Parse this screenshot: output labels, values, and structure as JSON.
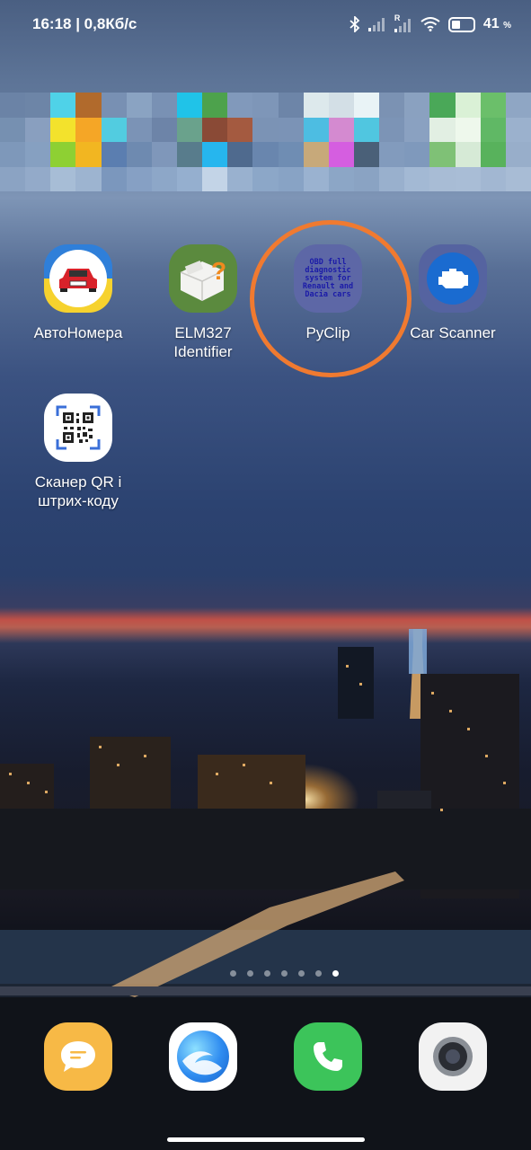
{
  "status_bar": {
    "time_speed": "16:18 | 0,8Кб/с",
    "network_r": "R",
    "battery_percent": "41",
    "battery_unit": "%",
    "battery_level": 0.41
  },
  "apps": [
    {
      "label": "АвтоНомера",
      "icon": "car-plate-icon"
    },
    {
      "label": "ELM327 Identifier",
      "icon": "obd-adapter-icon"
    },
    {
      "label": "PyClip",
      "icon_text": "OBD full diagnostic system for Renault and Dacia cars",
      "icon": "pyclip-icon"
    },
    {
      "label": "Car Scanner",
      "icon": "engine-check-icon"
    },
    {
      "label": "Сканер QR і штрих-коду",
      "icon": "qr-scanner-icon"
    }
  ],
  "page_indicator": {
    "count": 7,
    "active_index": 6
  },
  "dock": [
    {
      "icon": "messages-icon",
      "color": "#f7b946"
    },
    {
      "icon": "browser-icon",
      "color": "#2f8cf0"
    },
    {
      "icon": "phone-icon",
      "color": "#3cc45a"
    },
    {
      "icon": "camera-icon",
      "color": "#f2f2f2"
    }
  ],
  "colors": {
    "highlight_ring": "#f07a30"
  }
}
